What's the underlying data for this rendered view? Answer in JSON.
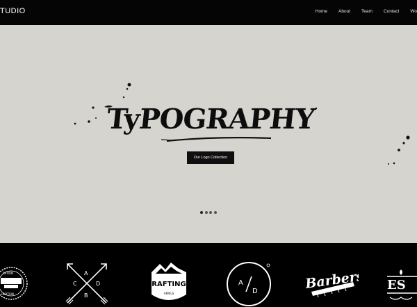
{
  "navbar": {
    "brand": "TUDIO",
    "links": [
      "Home",
      "About",
      "Team",
      "Contact",
      "Wo"
    ]
  },
  "hero": {
    "title": "TyPOGRAPHY",
    "cta_label": "Our Logo Collection",
    "slide_count": 4,
    "active_slide": 1
  },
  "logos": [
    {
      "name": "vintage-badge",
      "text": [
        "RATION",
        "HIBITION"
      ]
    },
    {
      "name": "crossed-arrows",
      "letters": [
        "A",
        "C",
        "D",
        "B"
      ]
    },
    {
      "name": "rafting",
      "text": [
        "RAFTING",
        "ARRILS"
      ]
    },
    {
      "name": "ad-circle",
      "letters": [
        "A",
        "D"
      ]
    },
    {
      "name": "barbers",
      "text": "Barbers"
    },
    {
      "name": "es-ornament",
      "text": "ES"
    }
  ],
  "colors": {
    "nav_bg": "#050505",
    "hero_bg": "#d6d4cf",
    "ink": "#0d0d0d",
    "button_bg": "#0f0f0f"
  }
}
